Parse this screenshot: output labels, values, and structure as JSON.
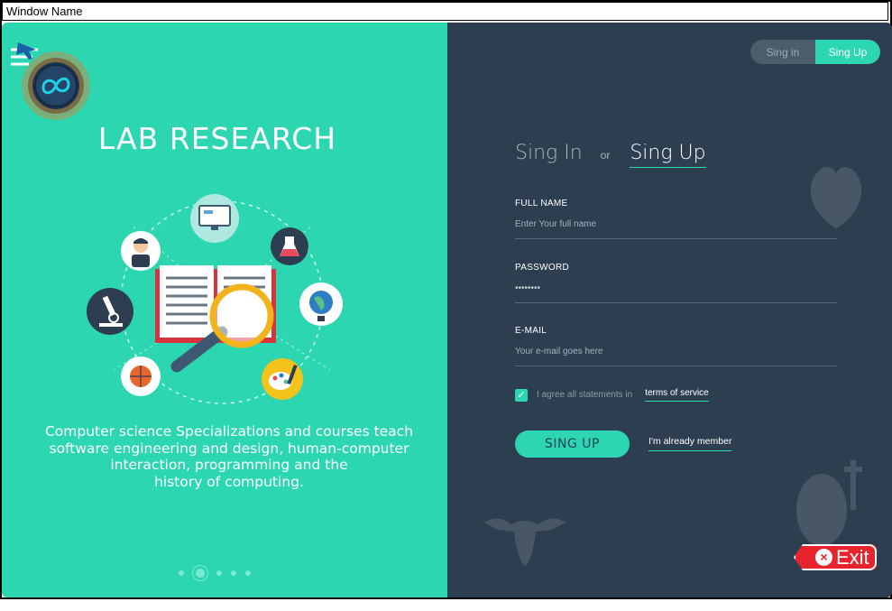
{
  "window": {
    "title": "Window Name"
  },
  "left": {
    "title": "LAB RESEARCH",
    "description_lines": [
      "Computer science Specializations and courses teach",
      "software engineering and design, human-computer",
      "interaction, programming and the",
      "history of computing."
    ],
    "pager": {
      "count": 5,
      "active": 2
    }
  },
  "right": {
    "toggle": {
      "signin": "Sing in",
      "signup": "Sing Up"
    },
    "heading": {
      "signin": "Sing In",
      "or": "or",
      "signup": "Sing Up"
    },
    "fields": {
      "fullname": {
        "label": "FULL NAME",
        "placeholder": "Enter Your full name"
      },
      "password": {
        "label": "PASSWORD",
        "value": "••••••••"
      },
      "email": {
        "label": "E-MAIL",
        "placeholder": "Your e-mail goes here"
      }
    },
    "agree": {
      "text": "I agree all statements in",
      "link": "terms of service",
      "checked": true
    },
    "signup_button": "SING UP",
    "member_link": "I'm already member"
  },
  "exit": {
    "label": "Exit"
  },
  "colors": {
    "teal": "#2cd6b1",
    "navy": "#2e3e51",
    "exit_red": "#e7242e"
  }
}
